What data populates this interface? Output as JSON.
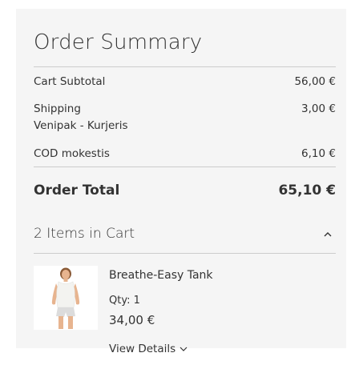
{
  "summary": {
    "title": "Order Summary",
    "cart_subtotal": {
      "label": "Cart Subtotal",
      "value": "56,00 €"
    },
    "shipping": {
      "label": "Shipping",
      "method": "Venipak - Kurjeris",
      "value": "3,00 €"
    },
    "cod": {
      "label": "COD mokestis",
      "value": "6,10 €"
    },
    "order_total": {
      "label": "Order Total",
      "value": "65,10 €"
    }
  },
  "cart": {
    "items_label": "2 Items in Cart",
    "items": [
      {
        "name": "Breathe-Easy Tank",
        "qty_label": "Qty:",
        "qty": "1",
        "price": "34,00 €",
        "details_label": "View Details",
        "image": "tank-top-product-photo"
      }
    ]
  },
  "colors": {
    "panel_background": "#f5f5f5",
    "divider": "#cccccc",
    "text": "#333333"
  },
  "icons": {
    "collapse": "chevron-up-icon",
    "details": "chevron-down-icon"
  }
}
